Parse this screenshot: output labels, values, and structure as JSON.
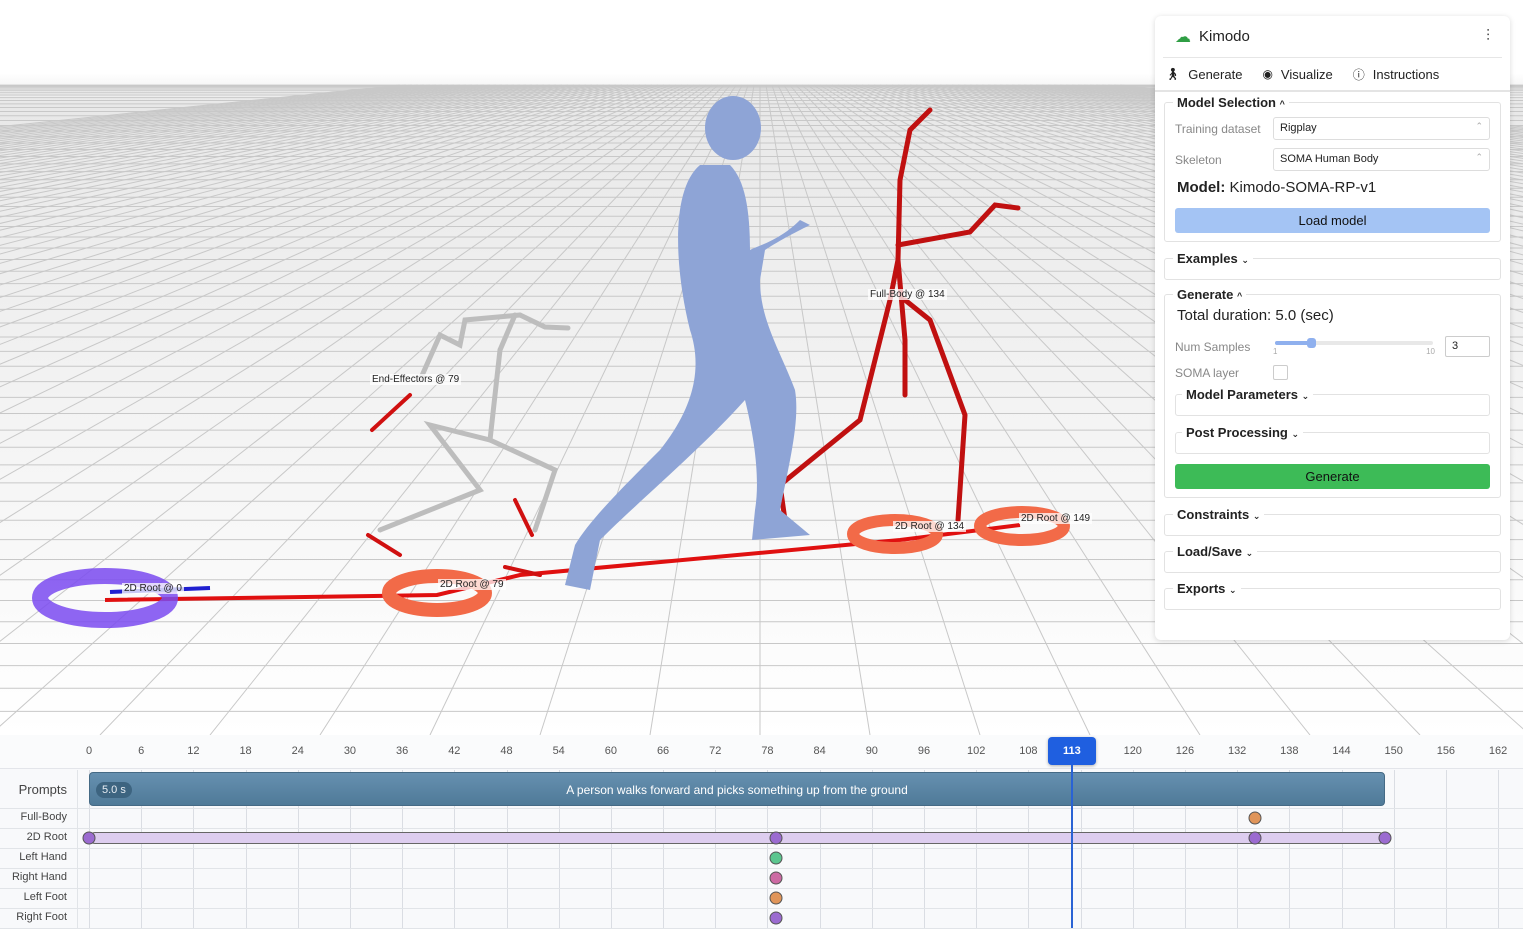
{
  "scene": {
    "labels": {
      "end_effectors": "End-Effectors @ 79",
      "full_body": "Full-Body @ 134",
      "root0": "2D Root @ 0",
      "root79": "2D Root @ 79",
      "root134": "2D Root @ 134",
      "root149": "2D Root @ 149"
    }
  },
  "panel": {
    "title": "Kimodo",
    "logo_icon": "cloud-icon",
    "settings_icon": "sliders-icon",
    "tabs": [
      {
        "label": "Generate",
        "icon": "walk-icon"
      },
      {
        "label": "Visualize",
        "icon": "eye-icon"
      },
      {
        "label": "Instructions",
        "icon": "info-icon"
      }
    ],
    "model_selection": {
      "title": "Model Selection",
      "training_dataset_label": "Training dataset",
      "training_dataset": "Rigplay",
      "skeleton_label": "Skeleton",
      "skeleton": "SOMA Human Body",
      "model_label": "Model:",
      "model_value": "Kimodo-SOMA-RP-v1",
      "load_button": "Load model"
    },
    "examples": "Examples",
    "generate": {
      "title": "Generate",
      "total_duration": "Total duration: 5.0 (sec)",
      "num_samples_label": "Num Samples",
      "num_samples": "3",
      "slider_min": "1",
      "slider_max": "10",
      "soma_layer_label": "SOMA layer",
      "soma_layer_checked": false,
      "model_parameters": "Model Parameters",
      "post_processing": "Post Processing",
      "generate_button": "Generate"
    },
    "constraints": "Constraints",
    "load_save": "Load/Save",
    "exports": "Exports",
    "colors": {
      "load_button": "#a4c4f4",
      "generate_button": "#3dbb57",
      "accent": "#2f9e44"
    }
  },
  "timeline": {
    "ticks": [
      "0",
      "6",
      "12",
      "18",
      "24",
      "30",
      "36",
      "42",
      "48",
      "54",
      "60",
      "66",
      "72",
      "78",
      "84",
      "90",
      "96",
      "102",
      "108",
      "120",
      "126",
      "132",
      "138",
      "144",
      "150",
      "156",
      "162"
    ],
    "current_frame": "113",
    "rows": [
      "Prompts",
      "Full-Body",
      "2D Root",
      "Left Hand",
      "Right Hand",
      "Left Foot",
      "Right Foot"
    ],
    "prompt": {
      "duration": "5.0 s",
      "text": "A person walks forward and picks something up from the ground",
      "start": 0,
      "end": 149
    },
    "root_span": {
      "start": 0,
      "end": 149
    },
    "keyframes": [
      {
        "row": "Full-Body",
        "frame": 134,
        "color": "#e0955a"
      },
      {
        "row": "2D Root",
        "frame": 0,
        "color": "#9b6bd0"
      },
      {
        "row": "2D Root",
        "frame": 79,
        "color": "#9b6bd0"
      },
      {
        "row": "2D Root",
        "frame": 134,
        "color": "#9b6bd0"
      },
      {
        "row": "2D Root",
        "frame": 149,
        "color": "#9b6bd0"
      },
      {
        "row": "Left Hand",
        "frame": 79,
        "color": "#5cc68f"
      },
      {
        "row": "Right Hand",
        "frame": 79,
        "color": "#cc6aa3"
      },
      {
        "row": "Left Foot",
        "frame": 79,
        "color": "#e0955a"
      },
      {
        "row": "Right Foot",
        "frame": 79,
        "color": "#9b6bd0"
      }
    ]
  }
}
